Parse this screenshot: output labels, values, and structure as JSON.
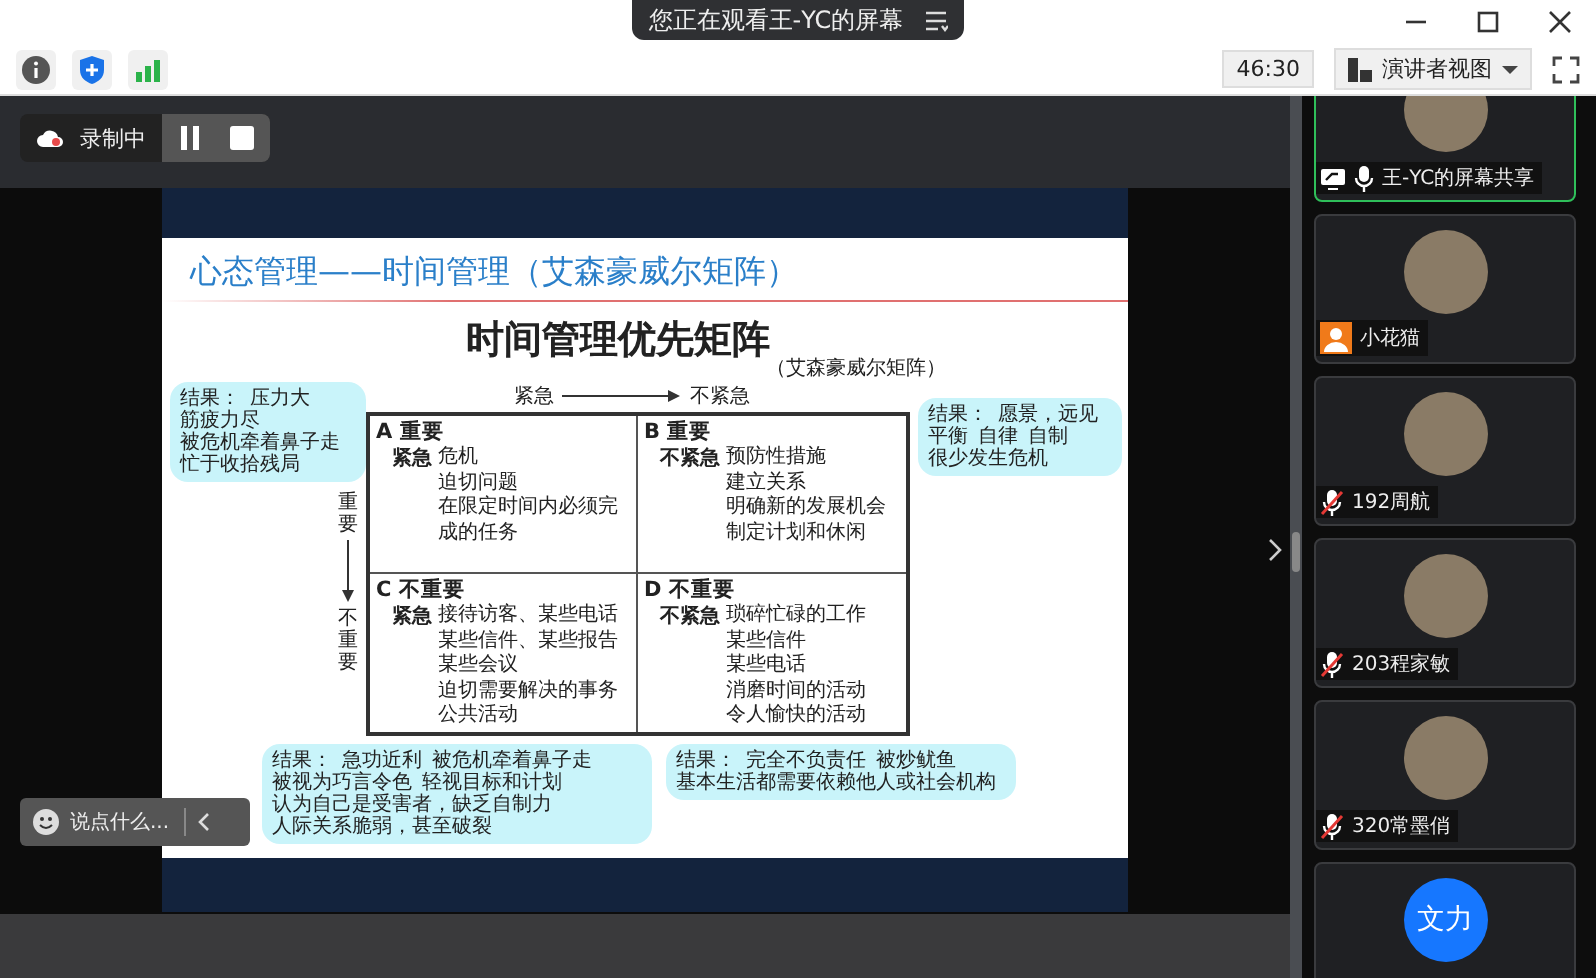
{
  "top_bar": {
    "banner": "您正在观看王-YC的屏幕",
    "timer": "46:30",
    "view_button": "演讲者视图"
  },
  "recording": {
    "label": "录制中",
    "paused": false
  },
  "slide": {
    "title": "心态管理——时间管理（艾森豪威尔矩阵）",
    "heading": "时间管理优先矩阵",
    "subheading": "（艾森豪威尔矩阵）",
    "x_axis": {
      "from": "紧急",
      "to": "不紧急"
    },
    "y_axis": {
      "from": "重要",
      "to": "不重要"
    },
    "quadrants": [
      {
        "letter": "A",
        "importance": "重要",
        "urgency": "紧急",
        "items": [
          "危机",
          "迫切问题",
          "在限定时间内必须完成的任务"
        ]
      },
      {
        "letter": "B",
        "importance": "重要",
        "urgency": "不紧急",
        "items": [
          "预防性措施",
          "建立关系",
          "明确新的发展机会",
          "制定计划和休闲"
        ]
      },
      {
        "letter": "C",
        "importance": "不重要",
        "urgency": "紧急",
        "items": [
          "接待访客、某些电话",
          "某些信件、某些报告",
          "某些会议",
          "迫切需要解决的事务",
          "公共活动"
        ]
      },
      {
        "letter": "D",
        "importance": "不重要",
        "urgency": "不紧急",
        "items": [
          "琐碎忙碌的工作",
          "某些信件",
          "某些电话",
          "消磨时间的活动",
          "令人愉快的活动"
        ]
      }
    ],
    "notes": [
      {
        "kind": "top-left",
        "lines": [
          "结果：",
          "压力大",
          "筋疲力尽",
          "被危机牵着鼻子走",
          "忙于收拾残局"
        ]
      },
      {
        "kind": "top-right",
        "lines": [
          "结果：",
          "愿景，远见",
          "平衡",
          "自律",
          "自制",
          "很少发生危机"
        ]
      },
      {
        "kind": "bottom-left",
        "lines": [
          "结果：",
          "急功近利",
          "被危机牵着鼻子走",
          "被视为巧言令色",
          "轻视目标和计划",
          "认为自己是受害者，缺乏自制力",
          "人际关系脆弱，甚至破裂"
        ]
      },
      {
        "kind": "bottom-right",
        "lines": [
          "结果：",
          "完全不负责任",
          "被炒鱿鱼",
          "基本生活都需要依赖他人或社会机构"
        ]
      }
    ]
  },
  "chat": {
    "placeholder": "说点什么..."
  },
  "participants": [
    {
      "kind": "sharing",
      "name": "王-YC的屏幕共享",
      "selected": true
    },
    {
      "kind": "guest",
      "name": "小花猫",
      "selected": false
    },
    {
      "kind": "muted",
      "name": "192周航",
      "selected": false
    },
    {
      "kind": "muted",
      "name": "203程家敏",
      "selected": false
    },
    {
      "kind": "muted",
      "name": "320常墨俏",
      "selected": false
    },
    {
      "kind": "initials",
      "avatar_text": "文力",
      "selected": false
    }
  ]
}
